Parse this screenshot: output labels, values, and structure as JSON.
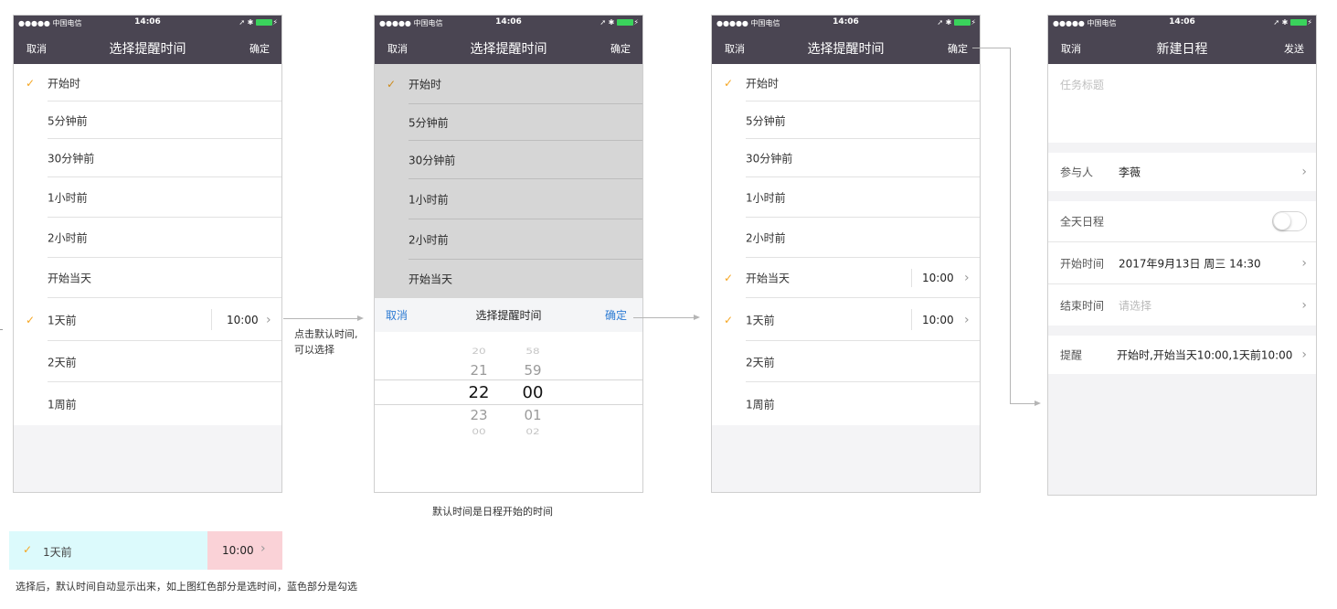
{
  "status": {
    "carrier": "●●●●● 中国电信",
    "time": "14:06"
  },
  "screen1": {
    "nav": {
      "left": "取消",
      "title": "选择提醒时间",
      "right": "确定"
    },
    "rows": [
      "开始时",
      "5分钟前",
      "30分钟前",
      "1小时前",
      "2小时前",
      "开始当天",
      "1天前",
      "2天前",
      "1周前"
    ],
    "selected_time": "10:00"
  },
  "screen2": {
    "nav": {
      "left": "取消",
      "title": "选择提醒时间",
      "right": "确定"
    },
    "rows": [
      "开始时",
      "5分钟前",
      "30分钟前",
      "1小时前",
      "2小时前",
      "开始当天"
    ],
    "picker": {
      "cancel": "取消",
      "title": "选择提醒时间",
      "confirm": "确定",
      "hours": [
        "20",
        "21",
        "22",
        "23",
        "00"
      ],
      "minutes": [
        "58",
        "59",
        "00",
        "01",
        "02"
      ]
    }
  },
  "screen3": {
    "nav": {
      "left": "取消",
      "title": "选择提醒时间",
      "right": "确定"
    },
    "rows": [
      "开始时",
      "5分钟前",
      "30分钟前",
      "1小时前",
      "2小时前",
      "开始当天",
      "1天前",
      "2天前",
      "1周前"
    ],
    "time_same_day": "10:00",
    "time_one_day": "10:00"
  },
  "screen4": {
    "nav": {
      "left": "取消",
      "title": "新建日程",
      "right": "发送"
    },
    "task_title_placeholder": "任务标题",
    "participants_label": "参与人",
    "participants_value": "李薇",
    "allday_label": "全天日程",
    "start_label": "开始时间",
    "start_value": "2017年9月13日  周三  14:30",
    "end_label": "结束时间",
    "end_placeholder": "请选择",
    "remind_label": "提醒",
    "remind_value": "开始时,开始当天10:00,1天前10:00"
  },
  "annotations": {
    "tap_default_time": "点击默认时间,",
    "can_select": "可以选择",
    "default_is_start": "默认时间是日程开始的时间",
    "legend_label": "1天前",
    "legend_time": "10:00",
    "legend_caption": "选择后，默认时间自动显示出来，如上图红色部分是选时间，蓝色部分是勾选"
  },
  "colors": {
    "nav_bg": "#4a4552",
    "check": "#f5a623",
    "link_blue": "#2d7bd3",
    "legend_blue": "#dcfafc",
    "legend_red": "#fad2d7"
  }
}
